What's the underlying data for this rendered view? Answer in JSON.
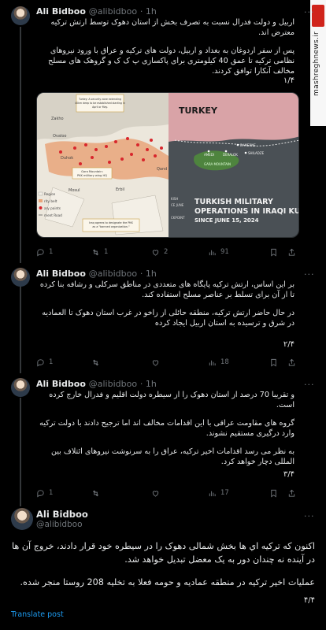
{
  "watermark": {
    "text": "mashreghnews.ir"
  },
  "tweets": [
    {
      "author": "Ali Bidboo",
      "handle": "@alibidboo",
      "time": "· 1h",
      "text": [
        "اربیل و دولت فدرال نسبت به تصرف بخش از استان دهوک توسط ارتش ترکیه معترض اند.",
        "پس از سفر اردوغان به بغداد و اربیل، دولت های ترکیه و عراق با ورود نیروهای نظامی ترکیه تا عمق 40 کیلومتری برای پاکسازی پ ک ک و گروهک های مسلح مخالف آنکارا توافق کردند."
      ],
      "counter": "۱/۴",
      "stats": {
        "replies": "1",
        "retweets": "1",
        "likes": "2",
        "views": "91"
      },
      "media": {
        "left_map": {
          "callout_top": "Turkey: A security zone extending 40km deep to be established starting in April or May.",
          "callout_mid": "Gara Mountain: PKK military wing HQ",
          "callout_bottom": "Iraq agrees to designate the PKK as a \"banned organization.\"",
          "places": [
            "Zakho",
            "Ovaloo",
            "Duhok",
            "Mosul",
            "Erbil",
            "Qand"
          ],
          "legend": [
            "Region",
            "rity belt",
            "ary points",
            "ment Road"
          ]
        },
        "right_map": {
          "country": "TURKEY",
          "places": [
            "BAMERNE",
            "SHILADZE",
            "AMEDI",
            "DERALOK",
            "GARA MOUNTAIN"
          ],
          "headline": "TURKISH MILITARY OPERATIONS IN IRAQI KUR",
          "subline": "SINCE JUNE 15, 2024",
          "side_labels": [
            "KISH",
            "CE JUNE",
            "CKPOINT"
          ]
        }
      }
    },
    {
      "author": "Ali Bidboo",
      "handle": "@alibidboo",
      "time": "· 1h",
      "text": [
        "بر این اساس، ارتش ترکیه پایگاه های متعددی در مناطق سرکلی و رشافه بنا کرده تا از آن برای تسلط بر عناصر مسلح استفاده کند.",
        "در حال حاضر ارتش ترکیه، منطقه حائلی از زاخو در غرب استان دهوک تا العمادیه در شرق و ترسیده به استان اربیل ایجاد کرده"
      ],
      "counter": "۲/۴",
      "stats": {
        "replies": "1",
        "retweets": "",
        "likes": "",
        "views": "18"
      }
    },
    {
      "author": "Ali Bidboo",
      "handle": "@alibidboo",
      "time": "· 1h",
      "text": [
        "و تقریبا 70 درصد از استان دهوک را از سیطره دولت اقلیم و فدرال خارج کرده است.",
        "گروه های مقاومت عراقی با این اقدامات مخالف اند اما ترجیح دادند با دولت ترکیه وارد درگیری مستقیم نشوند.",
        "به نظر می رسد اقدامات اخیر ترکیه، عراق را به سرنوشت نیروهای ائتلاف بین المللی دچار خواهد کرد."
      ],
      "counter": "۳/۴",
      "stats": {
        "replies": "1",
        "retweets": "",
        "likes": "",
        "views": "17"
      }
    },
    {
      "author": "Ali Bidboo",
      "handle": "@alibidboo",
      "text": [
        "اکنون که ترکیه اي ها بخش شمالی دهوک را در سیطره خود قرار دادند، خروج آن ها در آینده نه چندان دور به یک معضل تبدیل خواهد شد.",
        "عملیات اخیر ترکیه در منطقه عمادیه و حومه فعلا به تخلیه 208 روستا منجر شده."
      ],
      "counter": "۴/۴",
      "translate": "Translate post"
    }
  ]
}
